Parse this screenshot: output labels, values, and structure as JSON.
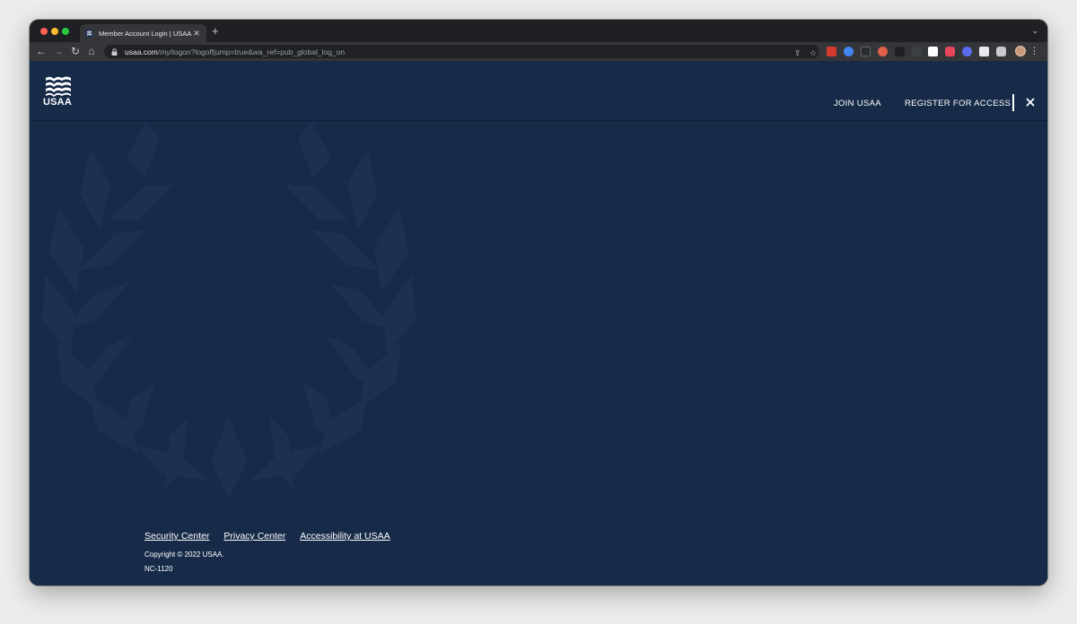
{
  "browser": {
    "tab": {
      "title": "Member Account Login | USAA"
    },
    "address_bar": {
      "host": "usaa.com",
      "path": "/my/logon?logoffjump=true&wa_ref=pub_global_log_on"
    },
    "icons": [
      "back-icon",
      "forward-icon",
      "reload-icon",
      "home-icon",
      "lock-icon",
      "share-icon",
      "star-icon",
      "extensions-icon",
      "menu-icon"
    ]
  },
  "header": {
    "logo_text": "USAA",
    "nav": {
      "join_label": "JOIN USAA",
      "register_label": "REGISTER FOR ACCESS"
    }
  },
  "footer": {
    "links": [
      "Security Center",
      "Privacy Center",
      "Accessibility at USAA"
    ],
    "copyright": "Copyright © 2022 USAA.",
    "code": "NC-1120"
  },
  "colors": {
    "page_background": "#172b49",
    "wreath": "#1c3152",
    "text": "#ffffff",
    "browser_chrome": "#35363a"
  }
}
